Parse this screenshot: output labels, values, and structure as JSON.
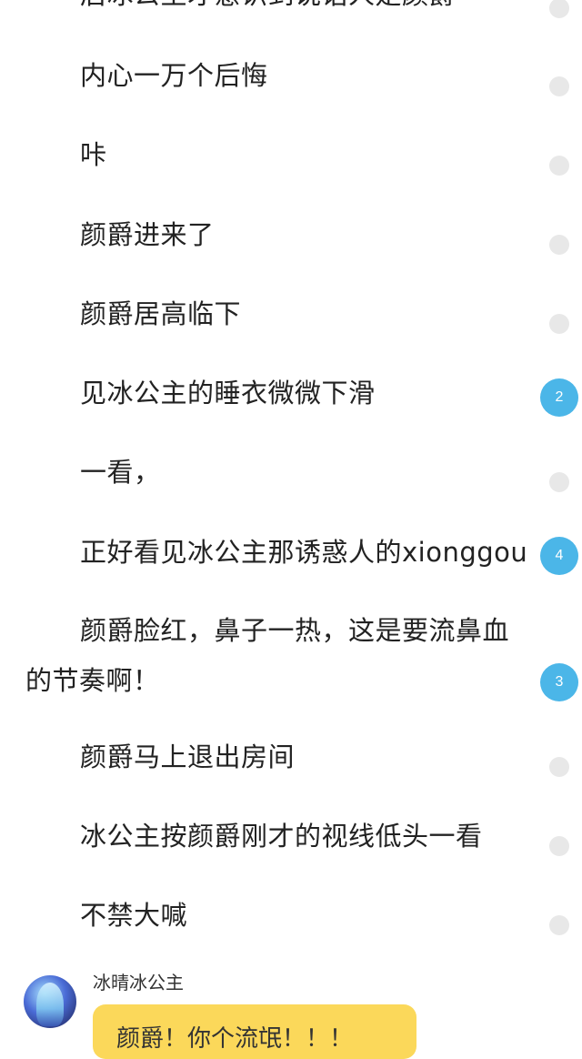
{
  "paragraphs": [
    {
      "text": "后冰公主才意识到说话人是颜爵",
      "comment_count": ""
    },
    {
      "text": "内心一万个后悔",
      "comment_count": ""
    },
    {
      "text": "咔",
      "comment_count": ""
    },
    {
      "text": "颜爵进来了",
      "comment_count": ""
    },
    {
      "text": "颜爵居高临下",
      "comment_count": ""
    },
    {
      "text": "见冰公主的睡衣微微下滑",
      "comment_count": "2"
    },
    {
      "text": "一看，",
      "comment_count": ""
    },
    {
      "text": "正好看见冰公主那诱惑人的xionggou",
      "comment_count": "4"
    },
    {
      "text": "颜爵脸红，鼻子一热，这是要流鼻血的节奏啊！",
      "comment_count": "3"
    },
    {
      "text": "颜爵马上退出房间",
      "comment_count": ""
    },
    {
      "text": "冰公主按颜爵刚才的视线低头一看",
      "comment_count": ""
    },
    {
      "text": "不禁大喊",
      "comment_count": ""
    }
  ],
  "comment": {
    "username": "冰晴冰公主",
    "text": "颜爵！你个流氓！！！"
  },
  "colors": {
    "badge": "#4bb6e8",
    "dot": "#e8e8e8",
    "bubble": "#fbd85a"
  }
}
